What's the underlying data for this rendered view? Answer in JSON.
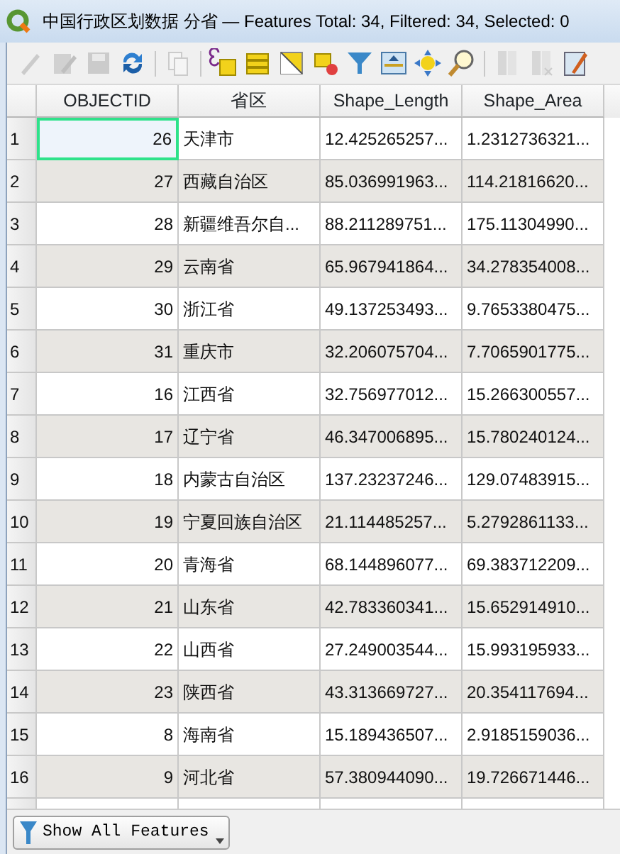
{
  "window": {
    "title": "中国行政区划数据 分省 — Features Total: 34, Filtered: 34, Selected: 0"
  },
  "toolbar": [
    {
      "kind": "pencil",
      "disabled": true
    },
    {
      "kind": "multi-edit",
      "disabled": true
    },
    {
      "kind": "save",
      "disabled": true
    },
    {
      "kind": "refresh",
      "disabled": false
    },
    {
      "kind": "separator"
    },
    {
      "kind": "copy",
      "disabled": true
    },
    {
      "kind": "separator"
    },
    {
      "kind": "expression-select",
      "disabled": false
    },
    {
      "kind": "select-all",
      "disabled": false
    },
    {
      "kind": "invert",
      "disabled": false
    },
    {
      "kind": "deselect",
      "disabled": false
    },
    {
      "kind": "filter",
      "disabled": false
    },
    {
      "kind": "move-top",
      "disabled": false
    },
    {
      "kind": "pan",
      "disabled": false
    },
    {
      "kind": "zoom",
      "disabled": false
    },
    {
      "kind": "separator"
    },
    {
      "kind": "new-field",
      "disabled": true
    },
    {
      "kind": "delete-field",
      "disabled": true
    },
    {
      "kind": "field-calculator",
      "disabled": false
    }
  ],
  "table": {
    "columns": [
      "OBJECTID",
      "省区",
      "Shape_Length",
      "Shape_Area"
    ],
    "rows": [
      {
        "number": "1",
        "cells": [
          "26",
          "天津市",
          "12.425265257...",
          "1.2312736321..."
        ],
        "focused": true
      },
      {
        "number": "2",
        "cells": [
          "27",
          "西藏自治区",
          "85.036991963...",
          "114.21816620..."
        ],
        "focused": false
      },
      {
        "number": "3",
        "cells": [
          "28",
          "新疆维吾尔自...",
          "88.211289751...",
          "175.11304990..."
        ],
        "focused": false
      },
      {
        "number": "4",
        "cells": [
          "29",
          "云南省",
          "65.967941864...",
          "34.278354008..."
        ],
        "focused": false
      },
      {
        "number": "5",
        "cells": [
          "30",
          "浙江省",
          "49.137253493...",
          "9.7653380475..."
        ],
        "focused": false
      },
      {
        "number": "6",
        "cells": [
          "31",
          "重庆市",
          "32.206075704...",
          "7.7065901775..."
        ],
        "focused": false
      },
      {
        "number": "7",
        "cells": [
          "16",
          "江西省",
          "32.756977012...",
          "15.266300557..."
        ],
        "focused": false
      },
      {
        "number": "8",
        "cells": [
          "17",
          "辽宁省",
          "46.347006895...",
          "15.780240124..."
        ],
        "focused": false
      },
      {
        "number": "9",
        "cells": [
          "18",
          "内蒙古自治区",
          "137.23237246...",
          "129.07483915..."
        ],
        "focused": false
      },
      {
        "number": "10",
        "cells": [
          "19",
          "宁夏回族自治区",
          "21.114485257...",
          "5.2792861133..."
        ],
        "focused": false
      },
      {
        "number": "11",
        "cells": [
          "20",
          "青海省",
          "68.144896077...",
          "69.383712209..."
        ],
        "focused": false
      },
      {
        "number": "12",
        "cells": [
          "21",
          "山东省",
          "42.783360341...",
          "15.652914910..."
        ],
        "focused": false
      },
      {
        "number": "13",
        "cells": [
          "22",
          "山西省",
          "27.249003544...",
          "15.993195933..."
        ],
        "focused": false
      },
      {
        "number": "14",
        "cells": [
          "23",
          "陕西省",
          "43.313669727...",
          "20.354117694..."
        ],
        "focused": false
      },
      {
        "number": "15",
        "cells": [
          "8",
          "海南省",
          "15.189436507...",
          "2.9185159036..."
        ],
        "focused": false
      },
      {
        "number": "16",
        "cells": [
          "9",
          "河北省",
          "57.380944090...",
          "19.726671446..."
        ],
        "focused": false
      }
    ]
  },
  "filter_button": {
    "label": "Show All Features"
  }
}
